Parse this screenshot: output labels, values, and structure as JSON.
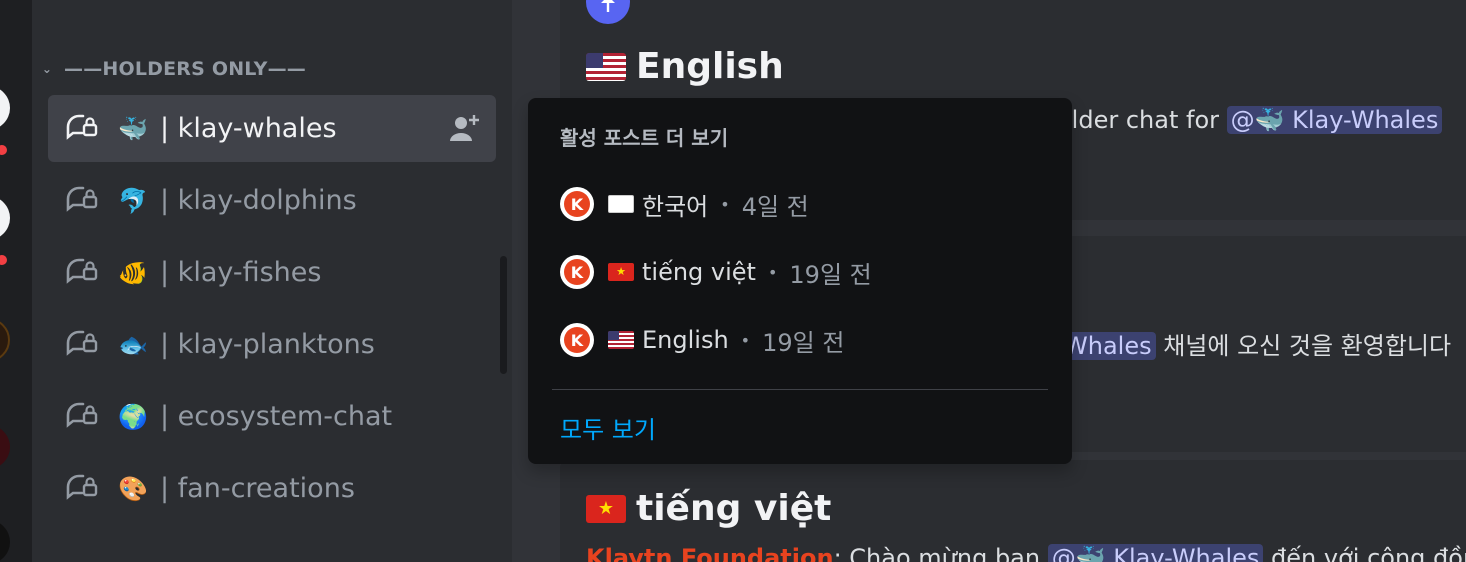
{
  "sidebar": {
    "category": {
      "label": "——HOLDERS ONLY——"
    },
    "channels": [
      {
        "emoji": "🐳",
        "label": "| klay-whales",
        "active": true
      },
      {
        "emoji": "🐬",
        "label": "| klay-dolphins"
      },
      {
        "emoji": "🐠",
        "label": "| klay-fishes"
      },
      {
        "emoji": "🐟",
        "label": "| klay-planktons"
      },
      {
        "emoji": "🌍",
        "label": "| ecosystem-chat"
      },
      {
        "emoji": "🎨",
        "label": "| fan-creations"
      }
    ]
  },
  "main": {
    "post1": {
      "title": "English",
      "line_prefix": "older chat for ",
      "mention": "@🐳 Klay-Whales"
    },
    "post2": {
      "mention": "Whales",
      "line_suffix": " 채널에 오신 것을 환영합니다"
    },
    "post3": {
      "title": "tiếng việt",
      "author": "Klaytn Foundation",
      "line_text": ": Chào mừng bạn ",
      "mention": "@🐳 Klay-Whales",
      "line_suffix": " đến với cộng đồng"
    }
  },
  "popup": {
    "title": "활성 포스트 더 보기",
    "posts": [
      {
        "label": "한국어",
        "separator": "•",
        "age": "4일 전",
        "flag": "kr"
      },
      {
        "label": "tiếng việt",
        "separator": "•",
        "age": "19일 전",
        "flag": "vn"
      },
      {
        "label": "English",
        "separator": "•",
        "age": "19일 전",
        "flag": "us"
      }
    ],
    "see_all": "모두 보기"
  },
  "colors": {
    "accent": "#5865f2",
    "link": "#00a8fc",
    "author": "#e8431f",
    "mention_bg": "#3c4270"
  }
}
